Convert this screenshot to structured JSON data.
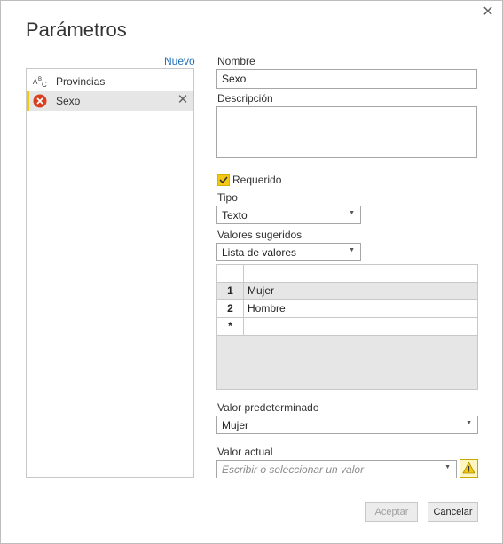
{
  "dialog": {
    "title": "Parámetros",
    "new_label": "Nuevo",
    "close_icon": "close-icon"
  },
  "parameters": [
    {
      "label": "Provincias",
      "icon": "text-type-icon",
      "selected": false
    },
    {
      "label": "Sexo",
      "icon": "error-icon",
      "selected": true
    }
  ],
  "form": {
    "name_label": "Nombre",
    "name_value": "Sexo",
    "description_label": "Descripción",
    "description_value": "",
    "required_label": "Requerido",
    "required_checked": true,
    "type_label": "Tipo",
    "type_value": "Texto",
    "suggested_label": "Valores sugeridos",
    "suggested_value": "Lista de valores",
    "values_table": [
      {
        "num": "1",
        "value": "Mujer"
      },
      {
        "num": "2",
        "value": "Hombre"
      },
      {
        "num": "*",
        "value": ""
      }
    ],
    "default_label": "Valor predeterminado",
    "default_value": "Mujer",
    "current_label": "Valor actual",
    "current_placeholder": "Escribir o seleccionar un valor"
  },
  "buttons": {
    "accept": "Aceptar",
    "cancel": "Cancelar"
  },
  "colors": {
    "accent_yellow": "#f2c811",
    "error_red": "#d9401f",
    "link_blue": "#1f6fb5"
  }
}
